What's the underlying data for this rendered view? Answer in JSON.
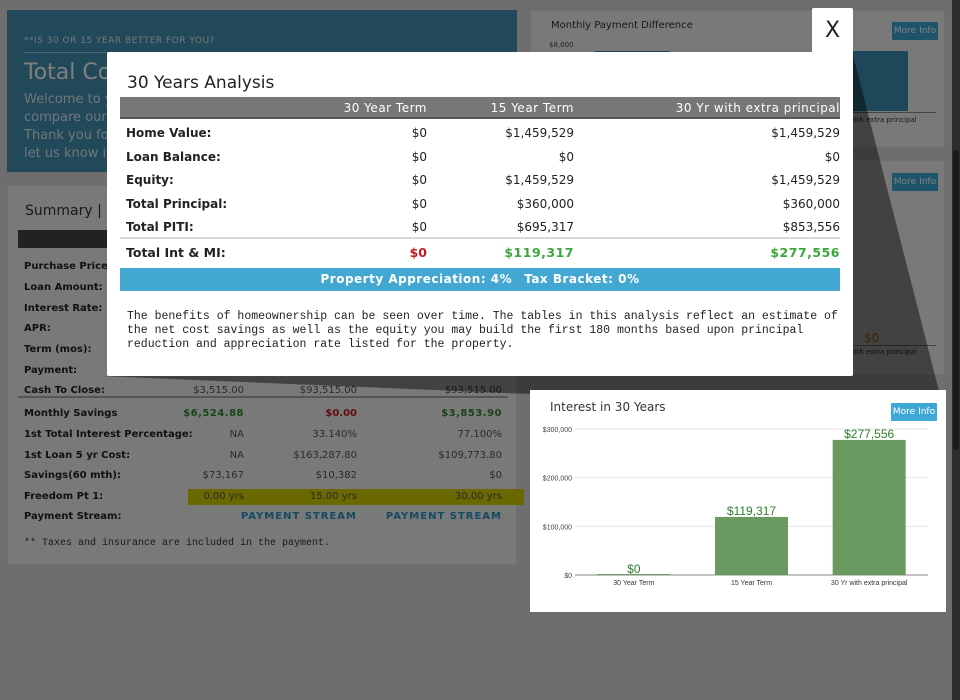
{
  "header": {
    "kicker": "**IS 30 OR 15 YEAR BETTER FOR YOU?",
    "title": "Total Co",
    "lines": [
      "Welcome to y",
      "compare our",
      "Thank you for",
      "let us know if"
    ]
  },
  "summary": {
    "title": "Summary  |",
    "rows": [
      {
        "label": "Purchase Price:"
      },
      {
        "label": "Loan Amount:"
      },
      {
        "label": "Interest Rate:"
      },
      {
        "label": "APR:"
      },
      {
        "label": "Term (mos):"
      },
      {
        "label": "Payment:"
      },
      {
        "label": "Cash To Close:",
        "v": [
          "$3,515.00",
          "$93,515.00",
          "$93,515.00"
        ]
      },
      {
        "label": "Monthly Savings",
        "v": [
          "$6,524.88",
          "$0.00",
          "$3,853.90"
        ]
      },
      {
        "label": "1st Total Interest Percentage:",
        "v": [
          "NA",
          "33.140%",
          "77.100%"
        ]
      },
      {
        "label": "1st Loan 5 yr Cost:",
        "v": [
          "NA",
          "$163,287.80",
          "$109,773.80"
        ]
      },
      {
        "label": "Savings(60 mth):",
        "v": [
          "$73,167",
          "$10,382",
          "$0"
        ]
      },
      {
        "label": "Freedom Pt 1:",
        "v": [
          "0.00 yrs",
          "15.00 yrs",
          "30.00 yrs"
        ]
      },
      {
        "label": "Payment Stream:",
        "v": [
          "",
          "PAYMENT STREAM",
          "PAYMENT STREAM"
        ]
      }
    ],
    "footnote": "** Taxes and insurance are included in the payment."
  },
  "right_cards": {
    "card1_title": "Monthly Payment Difference",
    "card1_tick": "$8,000",
    "card1_axis": "with extra principal",
    "card2_value": "$0",
    "card2_axis": "with extra principal",
    "more_info": "More Info"
  },
  "modal": {
    "close": "X",
    "title": "30 Years Analysis",
    "columns": [
      "30 Year Term",
      "15 Year Term",
      "30 Yr with extra principal"
    ],
    "rows": [
      {
        "label": "Home Value:",
        "v": [
          "$0",
          "$1,459,529",
          "$1,459,529"
        ]
      },
      {
        "label": "Loan Balance:",
        "v": [
          "$0",
          "$0",
          "$0"
        ]
      },
      {
        "label": "Equity:",
        "v": [
          "$0",
          "$1,459,529",
          "$1,459,529"
        ]
      },
      {
        "label": "Total Principal:",
        "v": [
          "$0",
          "$360,000",
          "$360,000"
        ]
      },
      {
        "label": "Total PITI:",
        "v": [
          "$0",
          "$695,317",
          "$853,556"
        ]
      }
    ],
    "total": {
      "label": "Total Int & MI:",
      "v": [
        "$0",
        "$119,317",
        "$277,556"
      ]
    },
    "appreciation": "Property Appreciation: 4%",
    "tax": "Tax Bracket: 0%",
    "paragraph": "The benefits of homeownership can be seen over time. The tables in this analysis reflect an estimate of the net cost savings as well as the equity you may build the first 180 months based upon principal reduction and appreciation rate listed for the property."
  },
  "chart_data": {
    "type": "bar",
    "title": "Interest in 30 Years",
    "categories": [
      "30 Year Term",
      "15 Year Term",
      "30 Yr with extra principal"
    ],
    "values": [
      0,
      119317,
      277556
    ],
    "data_labels": [
      "$0",
      "$119,317",
      "$277,556"
    ],
    "yticks": [
      "$0",
      "$100,000",
      "$200,000",
      "$300,000"
    ],
    "ylim": [
      0,
      300000
    ],
    "grid": true,
    "bar_color": "#6a9a60",
    "label_color": "#2f7f2f",
    "more_info": "More Info"
  }
}
